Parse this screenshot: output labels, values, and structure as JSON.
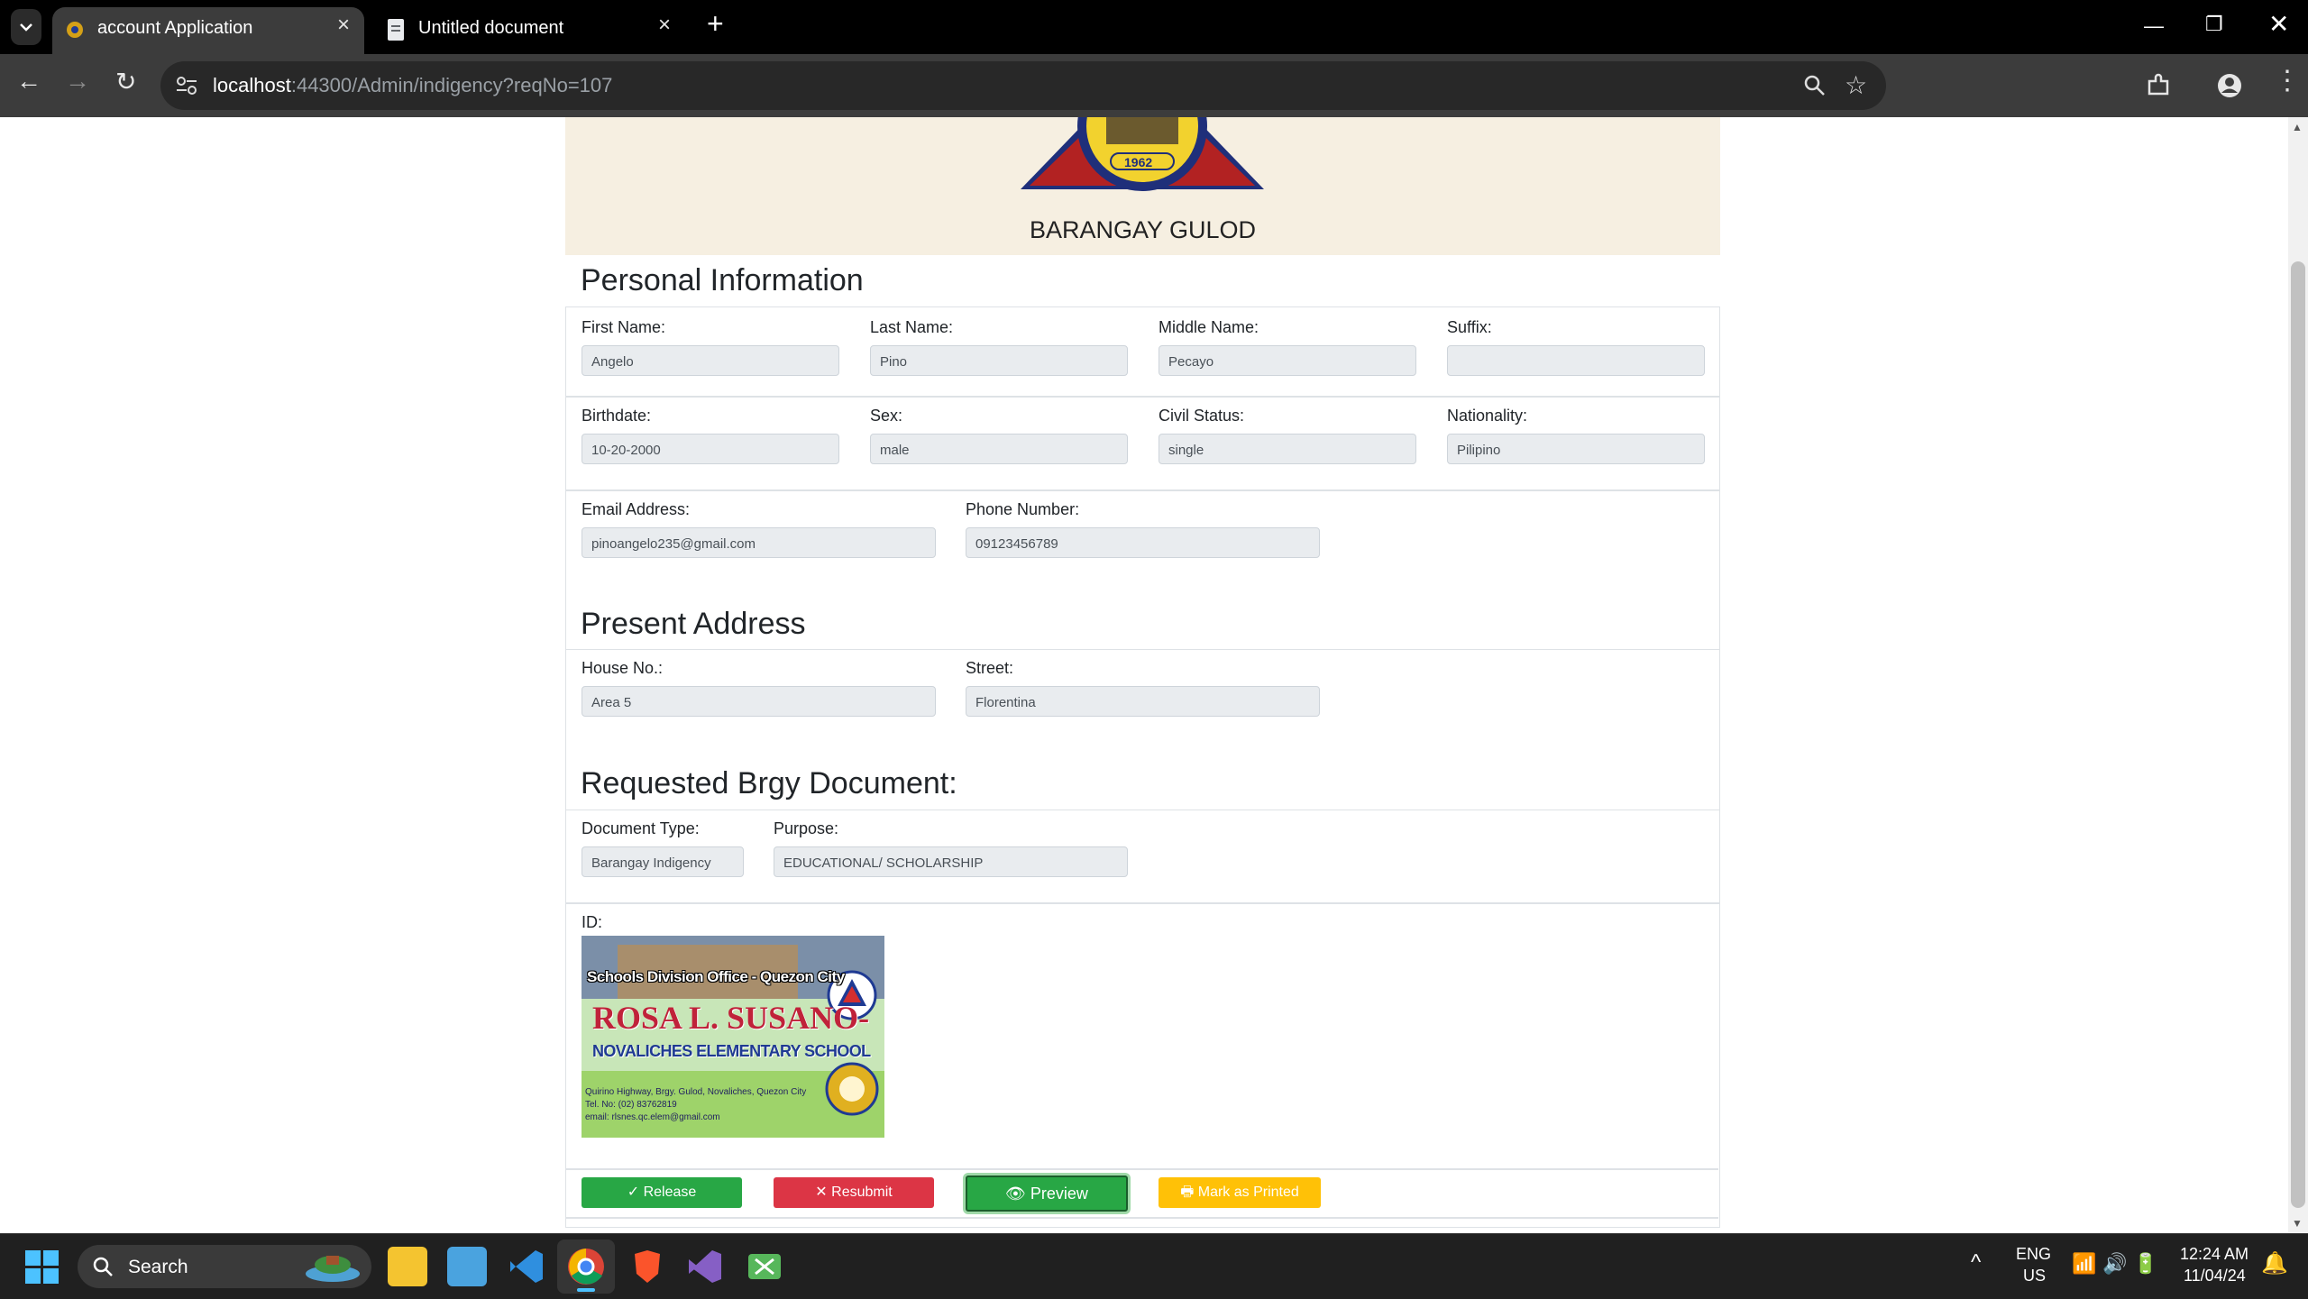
{
  "browser": {
    "tabs": [
      {
        "title": "account Application",
        "active": true
      },
      {
        "title": "Untitled document",
        "active": false
      }
    ],
    "url_host": "localhost",
    "url_rest": ":44300/Admin/indigency?reqNo=107"
  },
  "header": {
    "barangay_name": "BARANGAY GULOD",
    "seal_year": "1962"
  },
  "personal": {
    "title": "Personal Information",
    "first_name_label": "First Name:",
    "first_name": "Angelo",
    "last_name_label": "Last Name:",
    "last_name": "Pino",
    "middle_name_label": "Middle Name:",
    "middle_name": "Pecayo",
    "suffix_label": "Suffix:",
    "suffix": "",
    "birthdate_label": "Birthdate:",
    "birthdate": "10-20-2000",
    "sex_label": "Sex:",
    "sex": "male",
    "civil_status_label": "Civil Status:",
    "civil_status": "single",
    "nationality_label": "Nationality:",
    "nationality": "Pilipino",
    "email_label": "Email Address:",
    "email": "pinoangelo235@gmail.com",
    "phone_label": "Phone Number:",
    "phone": "09123456789"
  },
  "address": {
    "title": "Present Address",
    "house_label": "House No.:",
    "house": "Area 5",
    "street_label": "Street:",
    "street": "Florentina"
  },
  "document": {
    "title": "Requested Brgy Document:",
    "type_label": "Document Type:",
    "type": "Barangay Indigency",
    "purpose_label": "Purpose:",
    "purpose": "EDUCATIONAL/ SCHOLARSHIP",
    "id_label": "ID:",
    "id_image": {
      "line1": "Schools Division Office - Quezon City",
      "line2": "ROSA L. SUSANO-",
      "line3": "NOVALICHES ELEMENTARY SCHOOL",
      "line4": "Quirino Highway, Brgy. Gulod, Novaliches, Quezon City",
      "line5": "Tel. No: (02) 83762819",
      "line6": "email: rlsnes.qc.elem@gmail.com"
    }
  },
  "actions": {
    "release": "Release",
    "resubmit": "Resubmit",
    "preview": "Preview",
    "mark_printed": "Mark as Printed"
  },
  "taskbar": {
    "search_placeholder": "Search",
    "lang_line1": "ENG",
    "lang_line2": "US",
    "time": "12:24 AM",
    "date": "11/04/24"
  },
  "colors": {
    "release": "#28a745",
    "resubmit": "#dc3545",
    "preview": "#28a745",
    "mark_printed": "#ffc107"
  }
}
